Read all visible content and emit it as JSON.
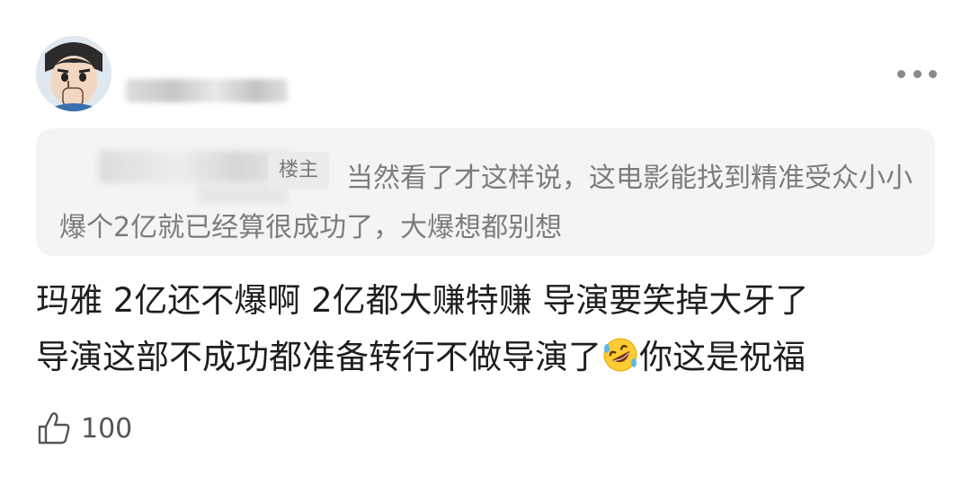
{
  "post": {
    "more_icon": "more-dots-icon",
    "avatar_icon": "cartoon-avatar-icon"
  },
  "quote": {
    "badge": "楼主",
    "text": "当然看了才这样说，这电影能找到精准受众小小爆个2亿就已经算很成功了，大爆想都别想"
  },
  "comment": {
    "line1": "玛雅 2亿还不爆啊 2亿都大赚特赚 导演要笑掉大牙了",
    "line2_before_emoji": "导演这部不成功都准备转行不做导演了",
    "line2_after_emoji": "你这是祝福",
    "emoji_icon": "rolling-laughing-emoji"
  },
  "like": {
    "icon": "thumbs-up-icon",
    "count": "100"
  }
}
